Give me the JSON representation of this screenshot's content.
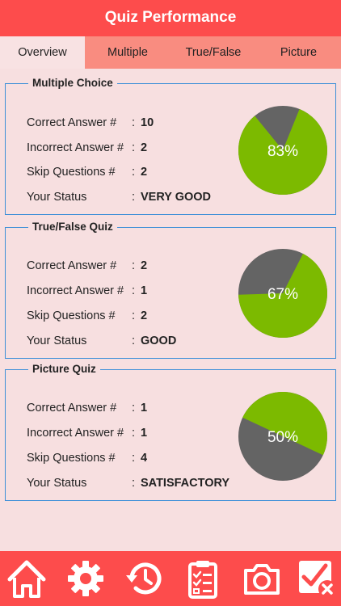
{
  "header": {
    "title": "Quiz Performance"
  },
  "tabs": [
    {
      "label": "Overview",
      "active": true
    },
    {
      "label": "Multiple",
      "active": false
    },
    {
      "label": "True/False",
      "active": false
    },
    {
      "label": "Picture",
      "active": false
    }
  ],
  "colon": ":",
  "colors": {
    "header": "#fd4c4c",
    "tabbar": "#f98c80",
    "background": "#f7dfe0",
    "border": "#3d8fd8",
    "pie_correct": "#7cba00",
    "pie_rest": "#646464"
  },
  "cards": [
    {
      "title": "Multiple Choice",
      "rows": [
        {
          "label": "Correct Answer #",
          "value": "10"
        },
        {
          "label": "Incorrect Answer #",
          "value": "2"
        },
        {
          "label": "Skip Questions #",
          "value": "2"
        },
        {
          "label": "Your Status",
          "value": "VERY GOOD"
        }
      ],
      "percent_label": "83%",
      "percent": 83
    },
    {
      "title": "True/False Quiz",
      "rows": [
        {
          "label": "Correct Answer #",
          "value": "2"
        },
        {
          "label": "Incorrect Answer #",
          "value": "1"
        },
        {
          "label": "Skip Questions #",
          "value": "2"
        },
        {
          "label": "Your Status",
          "value": "GOOD"
        }
      ],
      "percent_label": "67%",
      "percent": 67
    },
    {
      "title": "Picture Quiz",
      "rows": [
        {
          "label": "Correct Answer #",
          "value": "1"
        },
        {
          "label": "Incorrect Answer #",
          "value": "1"
        },
        {
          "label": "Skip Questions #",
          "value": "4"
        },
        {
          "label": "Your Status",
          "value": "SATISFACTORY"
        }
      ],
      "percent_label": "50%",
      "percent": 50
    }
  ],
  "footer_icons": [
    "home-icon",
    "settings-gear-icon",
    "history-icon",
    "checklist-clipboard-icon",
    "camera-icon",
    "close-check-box-icon"
  ]
}
